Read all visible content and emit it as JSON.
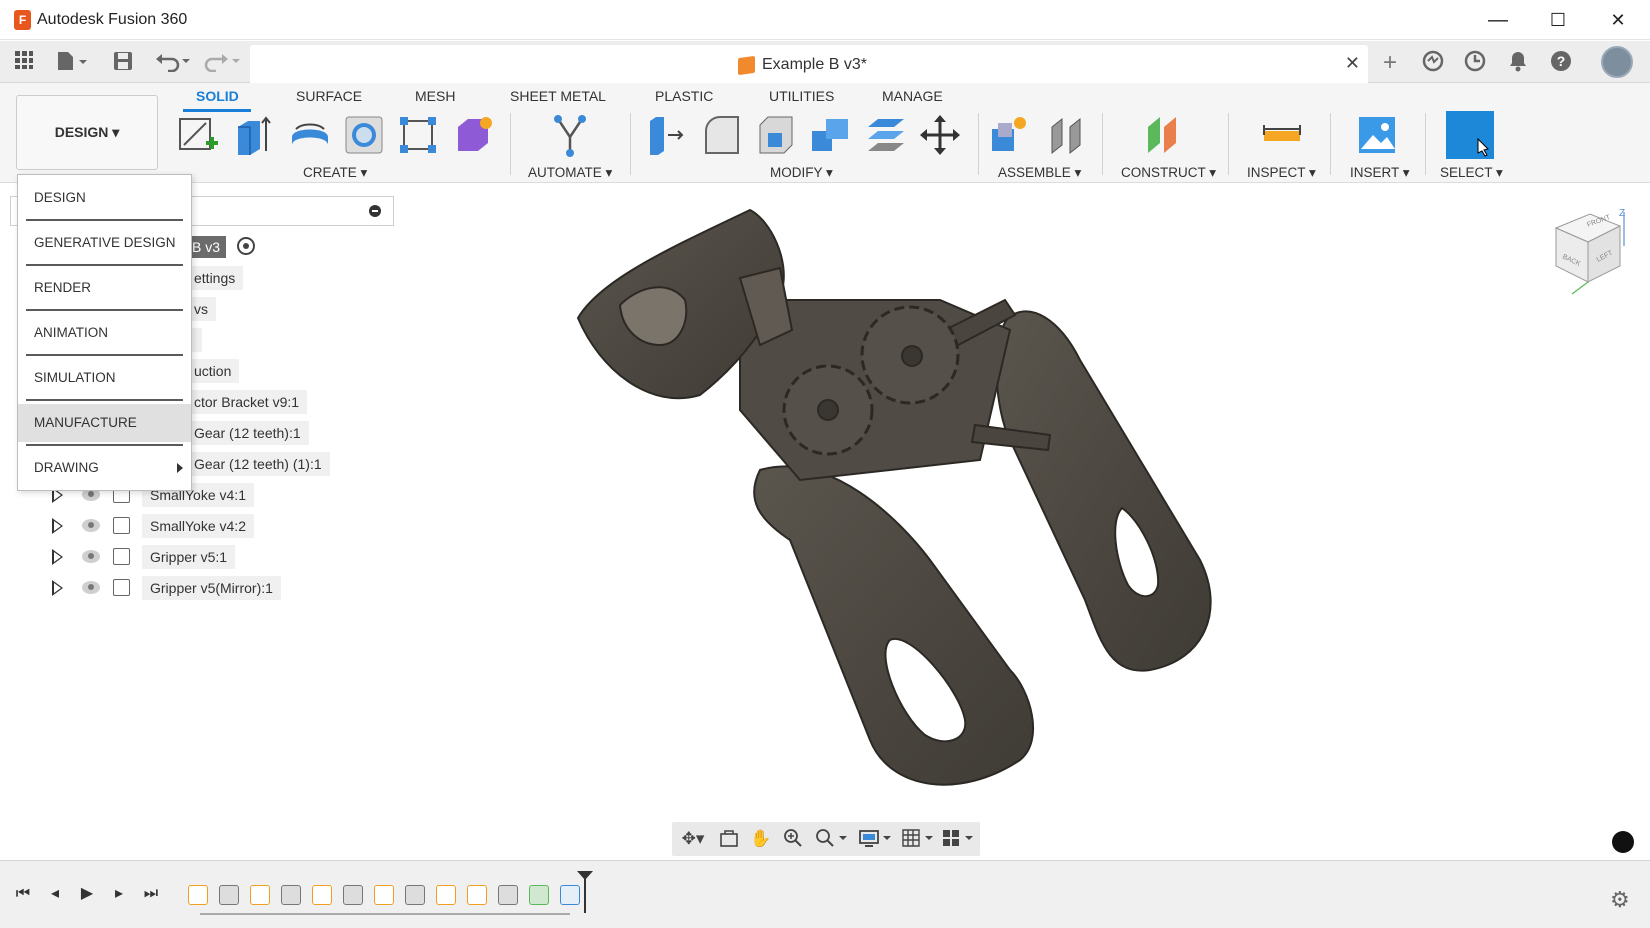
{
  "window": {
    "app_title": "Autodesk Fusion 360",
    "minimize": "—",
    "maximize": "☐",
    "close": "✕"
  },
  "appbar": {
    "doc_title": "Example B v3*",
    "doc_close": "✕",
    "icons": [
      "data-panel-icon",
      "file-icon",
      "save-icon",
      "undo-icon",
      "redo-icon",
      "new-tab-icon",
      "extensions-icon",
      "job-status-icon",
      "notifications-icon",
      "help-icon",
      "user-avatar"
    ]
  },
  "toolbar": {
    "workspace_label": "DESIGN ▾",
    "tabs": [
      "SOLID",
      "SURFACE",
      "MESH",
      "SHEET METAL",
      "PLASTIC",
      "UTILITIES",
      "MANAGE"
    ],
    "active_tab": "SOLID",
    "groups": [
      "CREATE ▾",
      "AUTOMATE ▾",
      "MODIFY ▾",
      "ASSEMBLE ▾",
      "CONSTRUCT ▾",
      "INSPECT ▾",
      "INSERT ▾",
      "SELECT ▾"
    ]
  },
  "workspace_menu": {
    "items": [
      "DESIGN",
      "GENERATIVE DESIGN",
      "RENDER",
      "ANIMATION",
      "SIMULATION",
      "MANUFACTURE",
      "DRAWING"
    ],
    "highlighted": "MANUFACTURE"
  },
  "browser": {
    "root": "B v3",
    "partial_rows": [
      "ettings",
      "vs",
      "",
      "uction",
      "ctor Bracket v9:1",
      "Gear (12 teeth):1",
      "Gear (12 teeth) (1):1"
    ],
    "components": [
      "SmallYoke v4:1",
      "SmallYoke v4:2",
      "Gripper v5:1",
      "Gripper v5(Mirror):1"
    ]
  },
  "viewcube": {
    "faces": [
      "FRONT",
      "BACK",
      "LEFT"
    ],
    "axis_z": "Z"
  },
  "nav_bar": {
    "icons": [
      "orbit-icon",
      "look-at-icon",
      "pan-icon",
      "zoom-window-icon",
      "zoom-icon",
      "display-settings-icon",
      "grid-settings-icon",
      "viewports-icon"
    ]
  },
  "timeline": {
    "controls": [
      "⏮",
      "◂",
      "▶",
      "▸",
      "⏭"
    ],
    "settings": "⚙"
  },
  "colors": {
    "accent": "#1a7fd6",
    "model": "#4a463f",
    "select_tool": "#1e88d8",
    "canvas": "#ffffff"
  }
}
